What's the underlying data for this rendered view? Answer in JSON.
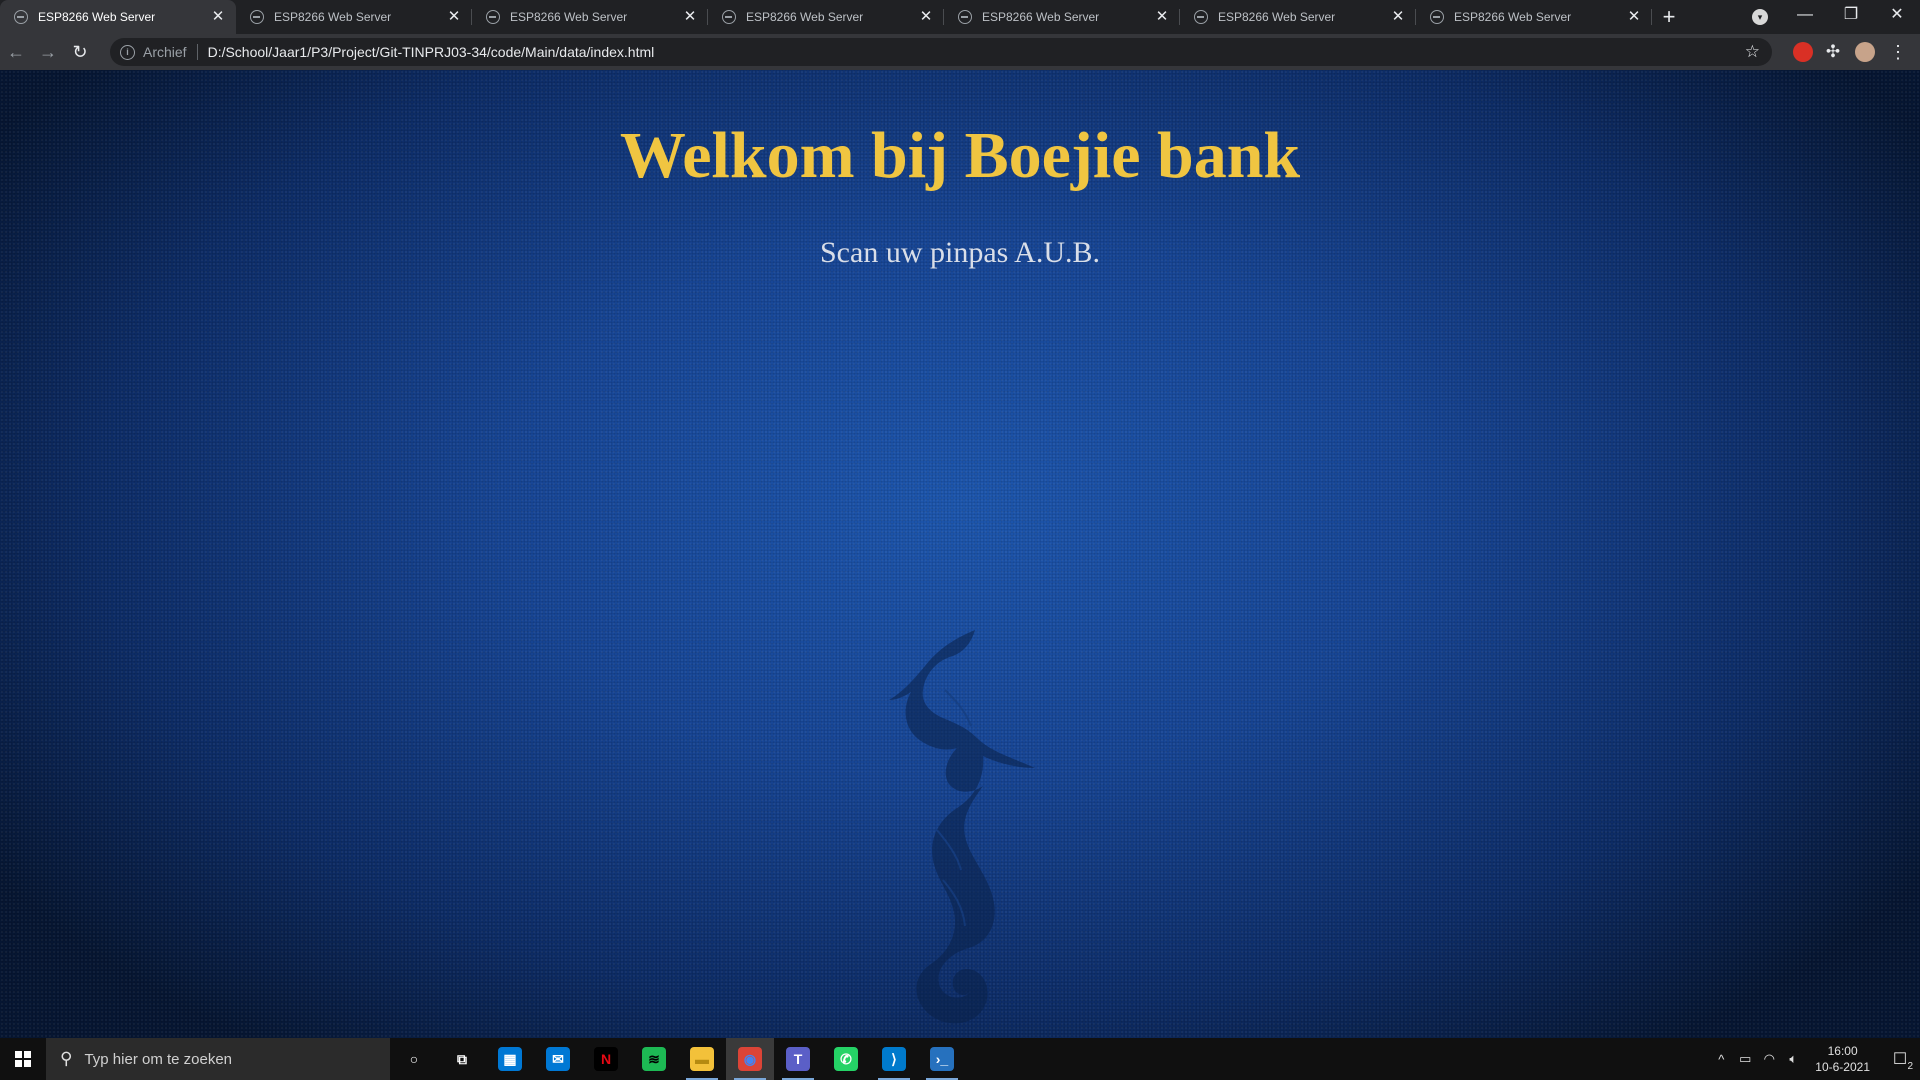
{
  "browser": {
    "tabs": [
      {
        "title": "ESP8266 Web Server",
        "active": true
      },
      {
        "title": "ESP8266 Web Server",
        "active": false
      },
      {
        "title": "ESP8266 Web Server",
        "active": false
      },
      {
        "title": "ESP8266 Web Server",
        "active": false
      },
      {
        "title": "ESP8266 Web Server",
        "active": false
      },
      {
        "title": "ESP8266 Web Server",
        "active": false
      },
      {
        "title": "ESP8266 Web Server",
        "active": false
      }
    ],
    "close_glyph": "✕",
    "new_tab_glyph": "+",
    "address": {
      "scheme_label": "Archief",
      "url": "D:/School/Jaar1/P3/Project/Git-TINPRJ03-34/code/Main/data/index.html"
    }
  },
  "page": {
    "heading": "Welkom bij Boejie bank",
    "subheading": "Scan uw pinpas A.U.B.",
    "colors": {
      "heading": "#f0c541",
      "subheading": "#d9dee8",
      "background": "#1d56ad"
    }
  },
  "taskbar": {
    "search_placeholder": "Typ hier om te zoeken",
    "pinned": [
      {
        "name": "cortana-icon"
      },
      {
        "name": "task-view-icon"
      },
      {
        "name": "microsoft-store-icon"
      },
      {
        "name": "mail-icon"
      },
      {
        "name": "netflix-icon"
      },
      {
        "name": "spotify-icon"
      },
      {
        "name": "file-explorer-icon"
      },
      {
        "name": "chrome-icon"
      },
      {
        "name": "teams-icon"
      },
      {
        "name": "whatsapp-icon"
      },
      {
        "name": "vscode-icon"
      },
      {
        "name": "powershell-icon"
      }
    ],
    "clock": {
      "time": "16:00",
      "date": "10-6-2021"
    },
    "notification_count": "2"
  }
}
